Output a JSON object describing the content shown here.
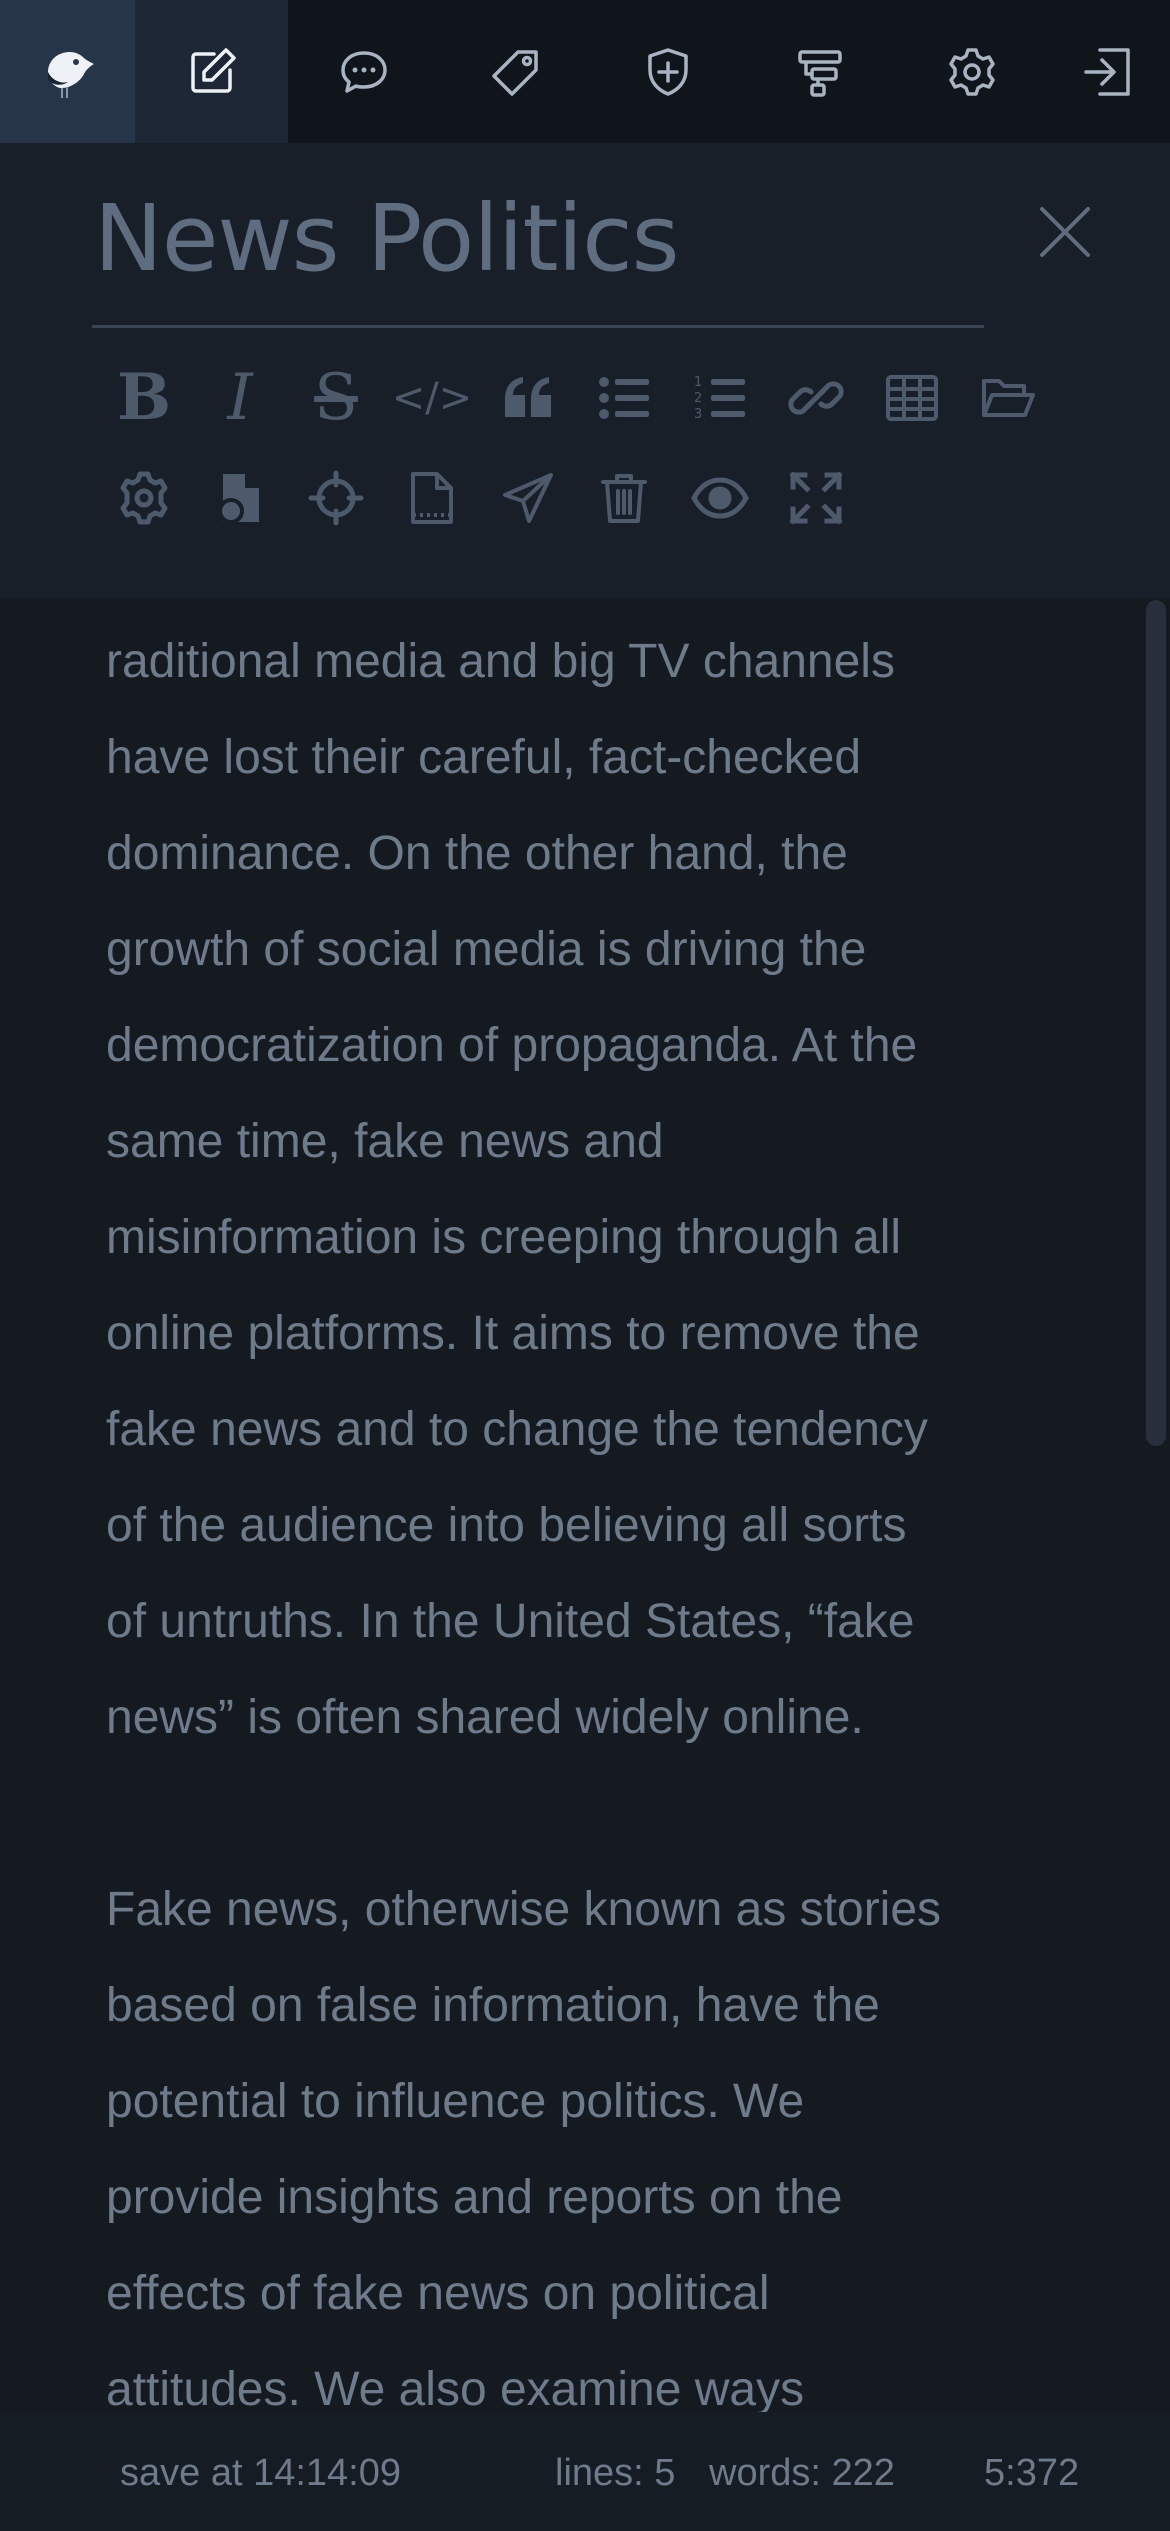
{
  "nav": {
    "icons": [
      "bird-logo-icon",
      "edit-icon",
      "chat-icon",
      "tag-icon",
      "shield-plus-icon",
      "sitemap-icon",
      "settings-icon",
      "logout-icon"
    ]
  },
  "editor": {
    "title": "News Politics",
    "toolbar": {
      "bold": "B",
      "italic": "I",
      "strike": "S",
      "code": "</>"
    }
  },
  "content": {
    "p1": [
      "raditional media and big TV channels",
      "have lost their careful, fact-checked",
      "dominance. On the other hand, the",
      "growth of social media is driving the",
      "democratization of propaganda. At the",
      "same time, fake news and",
      "misinformation is creeping through all",
      "online platforms. It aims to remove the",
      "fake news and to change the tendency",
      "of the audience into believing all sorts",
      "of untruths. In the United States,  “fake",
      "news”  is often shared widely online."
    ],
    "p2": [
      "Fake news, otherwise known as stories",
      "based on false information, have the",
      "potential to influence politics. We",
      "provide insights and reports on the",
      "effects of fake news on political",
      "attitudes. We also examine ways"
    ]
  },
  "status": {
    "save": "save at 14:14:09",
    "lines": "lines: 5",
    "words": "words: 222",
    "cursor": "5:372"
  },
  "colors": {
    "background": "#141a20",
    "topbar": "#10151c",
    "active_tab": "#263547",
    "text": "#6e7b8b",
    "icon": "#a9b4c2"
  }
}
